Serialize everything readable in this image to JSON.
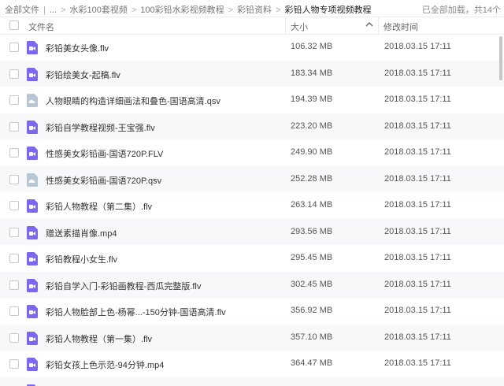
{
  "breadcrumb": {
    "items": [
      "全部文件",
      "...",
      "水彩100套视频",
      "100彩铅水彩视频教程",
      "彩铅资料"
    ],
    "current": "彩铅人物专项视频教程",
    "status": "已全部加载，共14个"
  },
  "header": {
    "name": "文件名",
    "size": "大小",
    "time": "修改时间"
  },
  "files": [
    {
      "name": "彩铅美女头像.flv",
      "size": "106.32 MB",
      "time": "2018.03.15 17:11",
      "icon": "video-file-icon"
    },
    {
      "name": "彩铅绘美女-起稿.flv",
      "size": "183.34 MB",
      "time": "2018.03.15 17:11",
      "icon": "video-file-icon"
    },
    {
      "name": "人物眼睛的构造详细画法和叠色-国语高清.qsv",
      "size": "194.39 MB",
      "time": "2018.03.15 17:11",
      "icon": "unknown-file-icon"
    },
    {
      "name": "彩铅自学教程视频-王宝强.flv",
      "size": "223.20 MB",
      "time": "2018.03.15 17:11",
      "icon": "video-file-icon"
    },
    {
      "name": "性感美女彩铅画-国语720P.FLV",
      "size": "249.90 MB",
      "time": "2018.03.15 17:11",
      "icon": "video-file-icon"
    },
    {
      "name": "性感美女彩铅画-国语720P.qsv",
      "size": "252.28 MB",
      "time": "2018.03.15 17:11",
      "icon": "unknown-file-icon"
    },
    {
      "name": "彩铅人物教程（第二集）.flv",
      "size": "263.14 MB",
      "time": "2018.03.15 17:11",
      "icon": "video-file-icon"
    },
    {
      "name": "赠送素描肖像.mp4",
      "size": "293.56 MB",
      "time": "2018.03.15 17:11",
      "icon": "video-file-icon"
    },
    {
      "name": "彩铅教程小女生.flv",
      "size": "295.45 MB",
      "time": "2018.03.15 17:11",
      "icon": "video-file-icon"
    },
    {
      "name": "彩铅自学入门-彩铅画教程-西瓜完整版.flv",
      "size": "302.45 MB",
      "time": "2018.03.15 17:11",
      "icon": "video-file-icon"
    },
    {
      "name": "彩铅人物脸部上色-杨幂...-150分钟-国语高清.flv",
      "size": "356.92 MB",
      "time": "2018.03.15 17:11",
      "icon": "video-file-icon"
    },
    {
      "name": "彩铅人物教程（第一集）.flv",
      "size": "357.10 MB",
      "time": "2018.03.15 17:11",
      "icon": "video-file-icon"
    },
    {
      "name": "彩铅女孩上色示范-94分钟.mp4",
      "size": "364.47 MB",
      "time": "2018.03.15 17:11",
      "icon": "video-file-icon"
    },
    {
      "name": "",
      "size": "",
      "time": "",
      "icon": "video-file-icon"
    }
  ],
  "colors": {
    "video_icon": "#7b68ee",
    "unknown_icon": "#b9c6d3",
    "row_alt": "#f7f8fa"
  }
}
